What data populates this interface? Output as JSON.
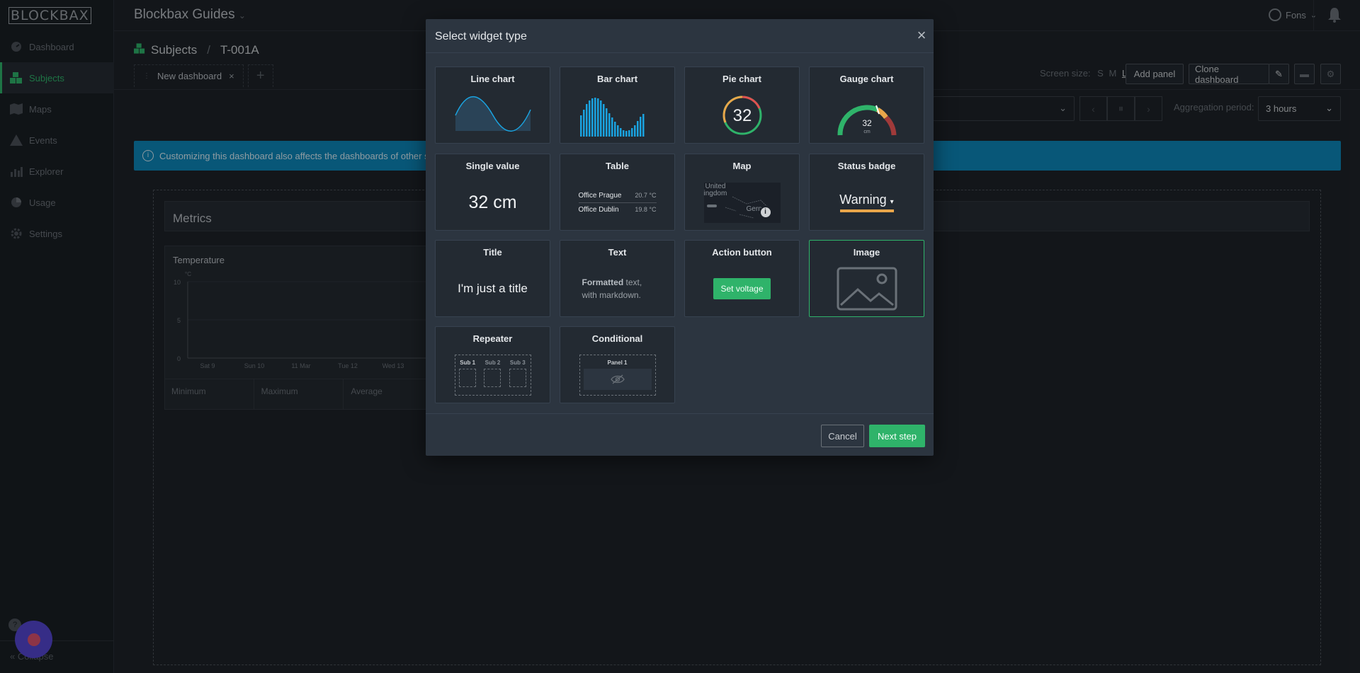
{
  "app": {
    "logo": "BLOCKBAX",
    "title": "Blockbax Guides",
    "user": "Fons"
  },
  "sidebar": {
    "items": [
      {
        "label": "Dashboard",
        "icon": "dashboard-icon"
      },
      {
        "label": "Subjects",
        "icon": "subjects-icon",
        "active": true
      },
      {
        "label": "Maps",
        "icon": "map-icon"
      },
      {
        "label": "Events",
        "icon": "warning-icon"
      },
      {
        "label": "Explorer",
        "icon": "chart-icon"
      },
      {
        "label": "Usage",
        "icon": "pie-icon"
      },
      {
        "label": "Settings",
        "icon": "gear-icon"
      }
    ],
    "collapse_label": "Collapse"
  },
  "breadcrumb": {
    "section": "Subjects",
    "item": "T-001A"
  },
  "tabs": [
    {
      "label": "New dashboard"
    }
  ],
  "toolbar": {
    "screen_size_label": "Screen size:",
    "size_s": "S",
    "size_m": "M",
    "size_l": "L",
    "add_panel": "Add panel",
    "clone_dashboard": "Clone dashboard"
  },
  "filters": {
    "aggregation_label": "Aggregation period:",
    "aggregation_value": "3 hours"
  },
  "banner": {
    "text": "Customizing this dashboard also affects the dashboards of other s"
  },
  "dashboard": {
    "metrics_title": "Metrics",
    "panel_title": "Temperature",
    "unit": "°C",
    "yticks": [
      "10",
      "5",
      "0"
    ],
    "xticks": [
      "Sat 9",
      "Sun 10",
      "11 Mar",
      "Tue 12",
      "Wed 13"
    ],
    "stats": [
      "Minimum",
      "Maximum",
      "Average"
    ]
  },
  "modal": {
    "title": "Select widget type",
    "cancel": "Cancel",
    "next": "Next step",
    "cards": {
      "line": "Line chart",
      "bar": "Bar chart",
      "pie": "Pie chart",
      "gauge": "Gauge chart",
      "single": "Single value",
      "table": "Table",
      "map": "Map",
      "status": "Status badge",
      "title": "Title",
      "text": "Text",
      "action": "Action button",
      "image": "Image",
      "repeater": "Repeater",
      "conditional": "Conditional"
    },
    "previews": {
      "pie_value": "32",
      "gauge_value": "32",
      "gauge_unit": "cm",
      "single_value": "32 cm",
      "table_rows": [
        {
          "name": "Office Prague",
          "value": "20.7 °C"
        },
        {
          "name": "Office Dublin",
          "value": "19.8 °C"
        }
      ],
      "map_label_1": "United",
      "map_label_2": "ingdom",
      "map_label_3": "Gern",
      "status_value": "Warning",
      "title_text": "I'm just a title",
      "text_bold": "Formatted",
      "text_rest": "text,",
      "text_line2": "with markdown.",
      "action_label": "Set voltage",
      "repeater_subs": [
        "Sub 1",
        "Sub 2",
        "Sub 3"
      ],
      "conditional_panel": "Panel 1"
    },
    "colors": {
      "accent": "#2fb36a",
      "chart_blue": "#1aa3e0",
      "warning": "#e9a64a"
    }
  }
}
